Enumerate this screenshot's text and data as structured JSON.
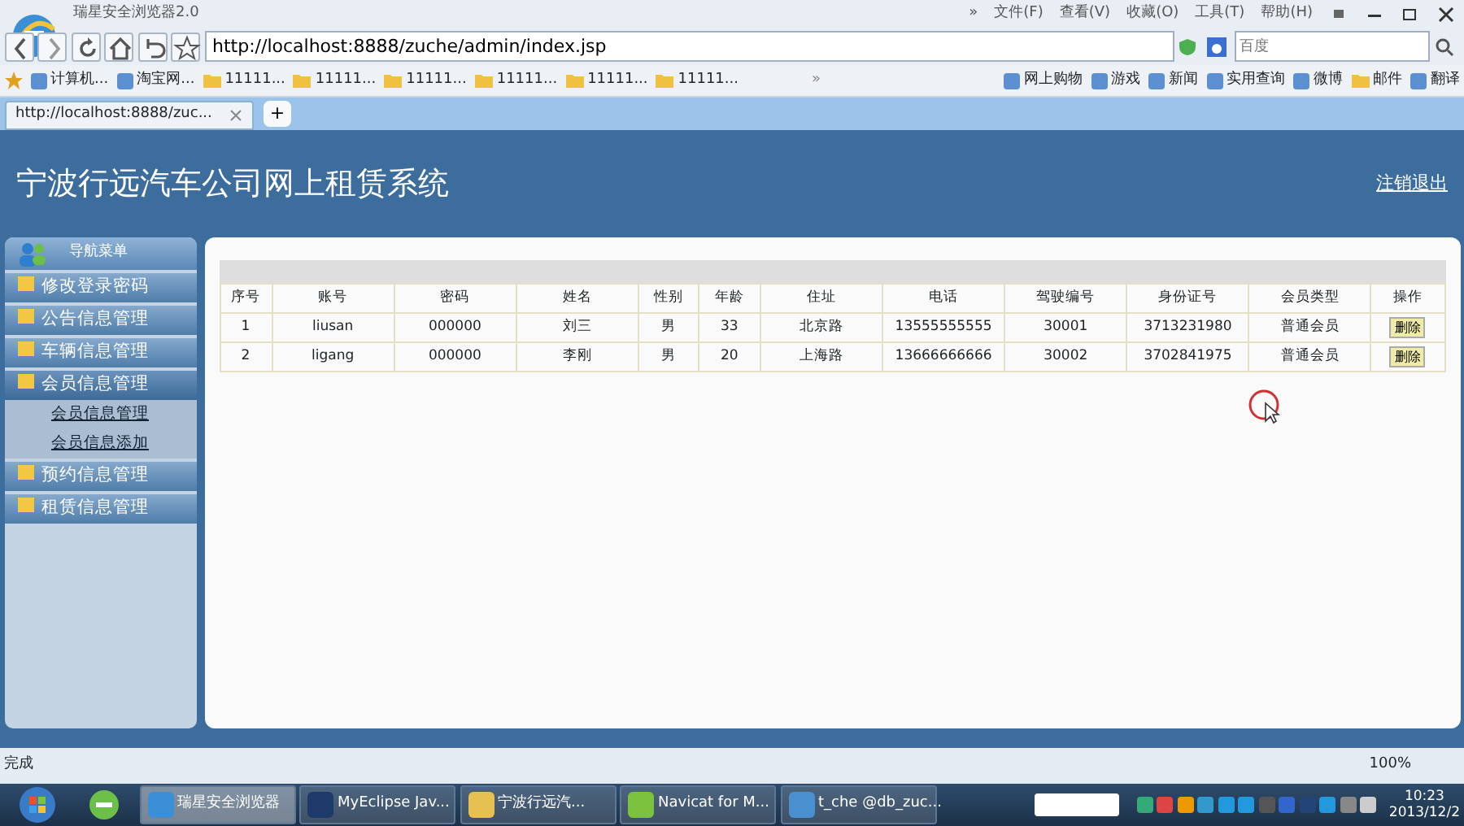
{
  "browser": {
    "title": "瑞星安全浏览器2.0",
    "menu": [
      "»",
      "文件(F)",
      "查看(V)",
      "收藏(O)",
      "工具(T)",
      "帮助(H)"
    ],
    "address": "http://localhost:8888/zuche/admin/index.jsp",
    "search": {
      "placeholder": "百度"
    },
    "bookmarks": [
      {
        "label": "计算机...",
        "kind": "app"
      },
      {
        "label": "淘宝网...",
        "kind": "app"
      },
      {
        "label": "11111...",
        "kind": "folder"
      },
      {
        "label": "11111...",
        "kind": "folder"
      },
      {
        "label": "11111...",
        "kind": "folder"
      },
      {
        "label": "11111...",
        "kind": "folder"
      },
      {
        "label": "11111...",
        "kind": "folder"
      },
      {
        "label": "11111...",
        "kind": "folder"
      },
      {
        "label": "»",
        "kind": "more"
      },
      {
        "label": "网上购物",
        "kind": "app"
      },
      {
        "label": "游戏",
        "kind": "app"
      },
      {
        "label": "新闻",
        "kind": "app"
      },
      {
        "label": "实用查询",
        "kind": "app"
      },
      {
        "label": "微博",
        "kind": "app"
      },
      {
        "label": "邮件",
        "kind": "folder"
      },
      {
        "label": "翻译",
        "kind": "app"
      }
    ],
    "tabs": [
      {
        "label": "http://localhost:8888/zuc...",
        "selected": true
      }
    ],
    "new_tab": "+"
  },
  "page": {
    "title": "宁波行远汽车公司网上租赁系统",
    "logout": "注销退出"
  },
  "sidebar": {
    "title": "导航菜单",
    "items": [
      {
        "label": "修改登录密码",
        "expanded": false
      },
      {
        "label": "公告信息管理",
        "expanded": false
      },
      {
        "label": "车辆信息管理",
        "expanded": false
      },
      {
        "label": "会员信息管理",
        "expanded": true,
        "children": [
          {
            "label": "会员信息管理"
          },
          {
            "label": "会员信息添加"
          }
        ]
      },
      {
        "label": "预约信息管理",
        "expanded": false
      },
      {
        "label": "租赁信息管理",
        "expanded": false
      }
    ]
  },
  "table": {
    "columns": [
      "序号",
      "账号",
      "密码",
      "姓名",
      "性别",
      "年龄",
      "住址",
      "电话",
      "驾驶编号",
      "身份证号",
      "会员类型",
      "操作"
    ],
    "rows": [
      {
        "cells": [
          "1",
          "liusan",
          "000000",
          "刘三",
          "男",
          "33",
          "北京路",
          "13555555555",
          "30001",
          "3713231980",
          "普通会员"
        ],
        "action": "删除"
      },
      {
        "cells": [
          "2",
          "ligang",
          "000000",
          "李刚",
          "男",
          "20",
          "上海路",
          "13666666666",
          "30002",
          "3702841975",
          "普通会员"
        ],
        "action": "删除"
      }
    ]
  },
  "status_bar": {
    "text": "完成",
    "zoom": "100%"
  },
  "taskbar": {
    "tasks": [
      {
        "label": "瑞星安全浏览器",
        "selected": true
      },
      {
        "label": "MyEclipse Jav...",
        "selected": false
      },
      {
        "label": "宁波行远汽...",
        "selected": false
      },
      {
        "label": "Navicat for M...",
        "selected": false
      },
      {
        "label": "t_che @db_zuc...",
        "selected": false
      }
    ],
    "time": "10:23",
    "date": "2013/12/2"
  }
}
